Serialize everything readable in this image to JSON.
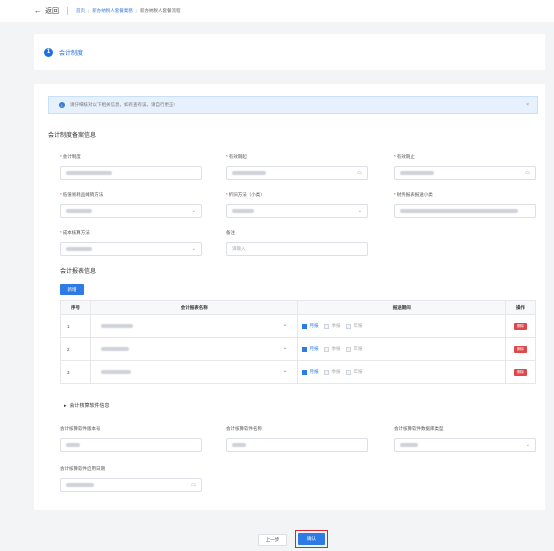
{
  "topbar": {
    "back_label": "返回",
    "breadcrumbs": [
      "首页",
      "新办纳税人套餐業務",
      "新办纳税人套餐流程"
    ]
  },
  "step": {
    "number": "1",
    "title": "会计制度"
  },
  "alert": {
    "text": "请仔细核对以下相关信息，如有查有误，请自行更正!"
  },
  "filing": {
    "section_title": "会计制度备案信息",
    "fields": [
      {
        "label": "会计制度",
        "required": true
      },
      {
        "label": "有效期起",
        "required": true
      },
      {
        "label": "有效期止",
        "required": true
      },
      {
        "label": "低值易耗品摊销方法",
        "required": true
      },
      {
        "label": "折旧方法（小类）",
        "required": true
      },
      {
        "label": "财务报表报送小类",
        "required": true
      },
      {
        "label": "成本核算方法",
        "required": true
      },
      {
        "label": "备注",
        "required": false,
        "placeholder": "请输入"
      }
    ]
  },
  "reports": {
    "section_title": "会计报表信息",
    "add_button": "新增",
    "columns": [
      "序号",
      "会计报表名称",
      "报送期间",
      "操作"
    ],
    "rows": [
      {
        "index": "1",
        "delete": "删除"
      },
      {
        "index": "2",
        "delete": "删除"
      },
      {
        "index": "3",
        "delete": "删除"
      }
    ],
    "period_options": [
      "月报",
      "季报",
      "年报"
    ]
  },
  "software": {
    "section_title": "会计核算软件信息",
    "fields": [
      {
        "label": "会计核算软件版本号"
      },
      {
        "label": "会计核算软件名称"
      },
      {
        "label": "会计核算软件数据库类型"
      },
      {
        "label": "会计核算软件启用日期"
      }
    ]
  },
  "footer": {
    "prev_label": "上一步",
    "confirm_label": "确认"
  },
  "colors": {
    "primary": "#2f7be6",
    "danger": "#e0464a",
    "highlight_border": "#d9262c"
  }
}
